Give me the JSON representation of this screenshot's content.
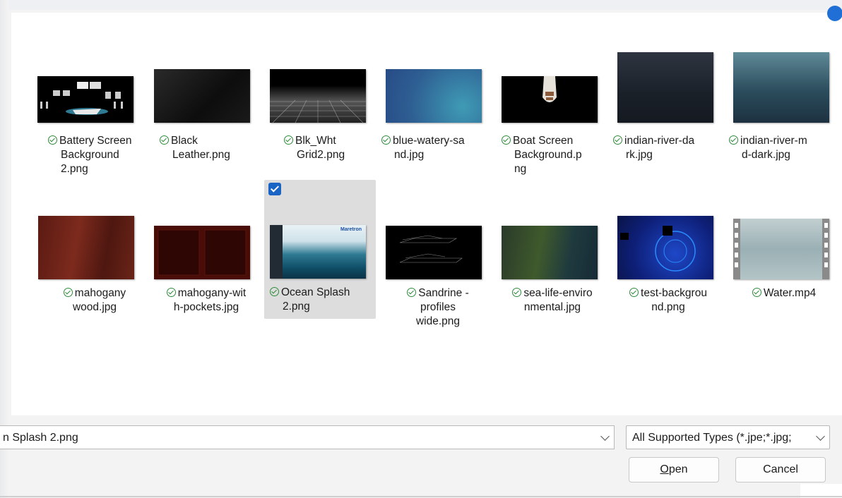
{
  "files": [
    {
      "caption": [
        "Battery Screen",
        "Background",
        "2.png"
      ],
      "status": "synced",
      "thumb": "battery-screen-thumbnail"
    },
    {
      "caption": [
        "Black",
        "Leather.png"
      ],
      "status": "synced",
      "thumb": "black-leather-thumbnail"
    },
    {
      "caption": [
        "Blk_Wht",
        "Grid2.png"
      ],
      "status": "synced",
      "thumb": "grid-thumbnail"
    },
    {
      "caption": [
        "blue-watery-sa",
        "nd.jpg"
      ],
      "status": "synced",
      "thumb": "blue-sand-thumbnail"
    },
    {
      "caption": [
        "Boat Screen",
        "Background.p",
        "ng"
      ],
      "status": "synced",
      "thumb": "boat-screen-thumbnail"
    },
    {
      "caption": [
        "indian-river-da",
        "rk.jpg"
      ],
      "status": "synced",
      "thumb": "indian-river-dark-thumbnail"
    },
    {
      "caption": [
        "indian-river-m",
        "d-dark.jpg"
      ],
      "status": "synced",
      "thumb": "indian-river-md-dark-thumbnail"
    },
    {
      "caption": [
        "mahogany",
        "wood.jpg"
      ],
      "status": "synced",
      "thumb": "mahogany-thumbnail"
    },
    {
      "caption": [
        "mahogany-wit",
        "h-pockets.jpg"
      ],
      "status": "synced",
      "thumb": "mahogany-pockets-thumbnail"
    },
    {
      "caption": [
        "Ocean Splash",
        "2.png"
      ],
      "status": "synced",
      "thumb": "ocean-splash-thumbnail",
      "selected": true
    },
    {
      "caption": [
        "Sandrine -",
        "profiles",
        "wide.png"
      ],
      "status": "synced",
      "thumb": "sandrine-thumbnail"
    },
    {
      "caption": [
        "sea-life-enviro",
        "nmental.jpg"
      ],
      "status": "synced",
      "thumb": "sea-life-thumbnail"
    },
    {
      "caption": [
        "test-backgrou",
        "nd.png"
      ],
      "status": "synced",
      "thumb": "test-background-thumbnail"
    },
    {
      "caption": [
        "Water.mp4"
      ],
      "status": "synced",
      "thumb": "video-thumbnail"
    }
  ],
  "thumb_brand_text": "Maretron",
  "filename": {
    "value": "n Splash 2.png"
  },
  "filter": {
    "value": "All Supported Types (*.jpe;*.jpg;"
  },
  "buttons": {
    "open": "Open",
    "open_mnemonic": "O",
    "open_rest": "pen",
    "cancel": "Cancel"
  },
  "colors": {
    "status_ok": "#2e8b3a",
    "accent": "#1a64c6",
    "selected_bg": "#dddddd"
  },
  "icons": {
    "status": "check-circle-icon",
    "dropdown": "chevron-down-icon"
  }
}
